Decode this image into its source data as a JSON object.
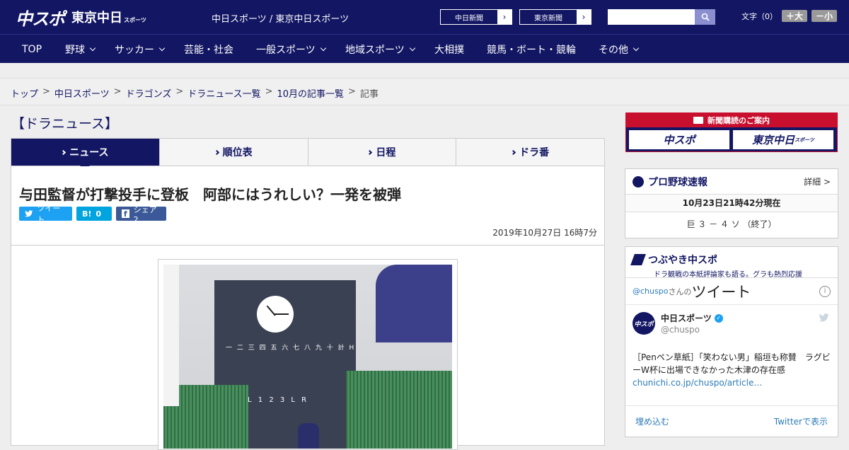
{
  "header": {
    "logo_main": "中スポ",
    "logo_sub": "東京中日",
    "logo_sub_small": "スポーツ",
    "site_name": "中日スポーツ / 東京中日スポーツ",
    "btn1": "中日新聞",
    "btn2": "東京新聞",
    "search_placeholder": "",
    "font_label": "文字（0）",
    "font_bigger": "＋大",
    "font_smaller": "－小"
  },
  "nav": [
    {
      "label": "TOP",
      "chevron": false
    },
    {
      "label": "野球",
      "chevron": true
    },
    {
      "label": "サッカー",
      "chevron": true
    },
    {
      "label": "芸能・社会",
      "chevron": false
    },
    {
      "label": "一般スポーツ",
      "chevron": true
    },
    {
      "label": "地域スポーツ",
      "chevron": true
    },
    {
      "label": "大相撲",
      "chevron": false
    },
    {
      "label": "競馬・ボート・競輪",
      "chevron": false
    },
    {
      "label": "その他",
      "chevron": true
    }
  ],
  "breadcrumb": {
    "items": [
      "トップ",
      "中日スポーツ",
      "ドラゴンズ",
      "ドラニュース一覧",
      "10月の記事一覧"
    ],
    "current": "記事",
    "sep": ">"
  },
  "section_title": "【ドラニュース】",
  "tabs": [
    "ニュース",
    "順位表",
    "日程",
    "ドラ番"
  ],
  "article": {
    "headline": "与田監督が打撃投手に登板　阿部にはうれしい？一発を被弾",
    "tweet": "ツイート",
    "hatena_count": "0",
    "fb_share": "シェア 2",
    "date": "2019年10月27日 16時7分",
    "scoreboard_text": "一 二 三 四 五 六 七 八 九 十  計  H",
    "scoreboard_row2": "PL 1 2 3 L R"
  },
  "ad": {
    "title": "新聞購読のご案内",
    "left": "中スポ",
    "right": "東京中日",
    "right_small": "スポーツ"
  },
  "score": {
    "title": "プロ野球速報",
    "detail": "詳細 >",
    "as_of": "10月23日21時42分現在",
    "result": "巨 ３ － ４ ソ （終了）"
  },
  "twitter": {
    "title": "つぶやき中スポ",
    "subtitle": "ドラ観戦の本紙評論家も語る。グラも熱烈応援",
    "handle_prefix": "@chuspo",
    "handle_suffix": "さんの",
    "tweets_word": "ツイート",
    "name": "中日スポーツ",
    "handle": "@chuspo",
    "text": "［Penペン草紙］「笑わない男」稲垣も称賛　ラグビーW杯に出場できなかった木津の存在感",
    "link": "chunichi.co.jp/chuspo/article…",
    "embed": "埋め込む",
    "view_on": "Twitterで表示"
  }
}
